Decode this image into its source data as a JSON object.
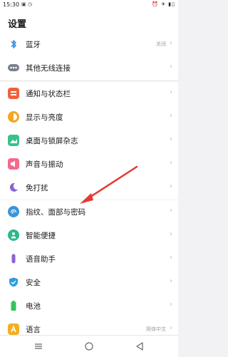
{
  "status_bar": {
    "time": "15:30",
    "notification_icons": "▣ ◷",
    "right_icons": "⏰ ✈ ▮▯"
  },
  "header": {
    "title": "设置"
  },
  "sections": [
    {
      "items": [
        {
          "id": "bluetooth",
          "label": "蓝牙",
          "value": "关闭",
          "icon": "bluetooth-icon",
          "color": "#3a8ee6"
        },
        {
          "id": "other-wireless",
          "label": "其他无线连接",
          "value": "",
          "icon": "more-dots-icon",
          "color": "#7a7f8e"
        }
      ]
    },
    {
      "items": [
        {
          "id": "notifications",
          "label": "通知与状态栏",
          "value": "",
          "icon": "notification-icon",
          "color": "#f0613b"
        },
        {
          "id": "display",
          "label": "显示与亮度",
          "value": "",
          "icon": "brightness-icon",
          "color": "#f4a623"
        },
        {
          "id": "desktop",
          "label": "桌面与锁屏杂志",
          "value": "",
          "icon": "wallpaper-icon",
          "color": "#36c28a"
        },
        {
          "id": "sound",
          "label": "声音与振动",
          "value": "",
          "icon": "speaker-icon",
          "color": "#f46a8c"
        },
        {
          "id": "dnd",
          "label": "免打扰",
          "value": "",
          "icon": "moon-icon",
          "color": "#8a63d2"
        }
      ]
    },
    {
      "items": [
        {
          "id": "security-unlock",
          "label": "指纹、面部与密码",
          "value": "",
          "icon": "fingerprint-icon",
          "color": "#3a96d9"
        },
        {
          "id": "smart",
          "label": "智能便捷",
          "value": "",
          "icon": "smart-icon",
          "color": "#2bb88a"
        },
        {
          "id": "assistant",
          "label": "语音助手",
          "value": "",
          "icon": "microphone-icon",
          "color": "#8a63d2"
        },
        {
          "id": "safety",
          "label": "安全",
          "value": "",
          "icon": "shield-icon",
          "color": "#2f9be0"
        },
        {
          "id": "battery",
          "label": "电池",
          "value": "",
          "icon": "battery-icon",
          "color": "#37c25c"
        },
        {
          "id": "language",
          "label": "语言",
          "value": "简体中文",
          "icon": "language-icon",
          "color": "#f2b01e"
        }
      ]
    }
  ],
  "nav_bar": {
    "left": "menu-icon",
    "center": "home-icon",
    "right": "back-icon"
  },
  "annotation": {
    "color": "#e53935"
  }
}
